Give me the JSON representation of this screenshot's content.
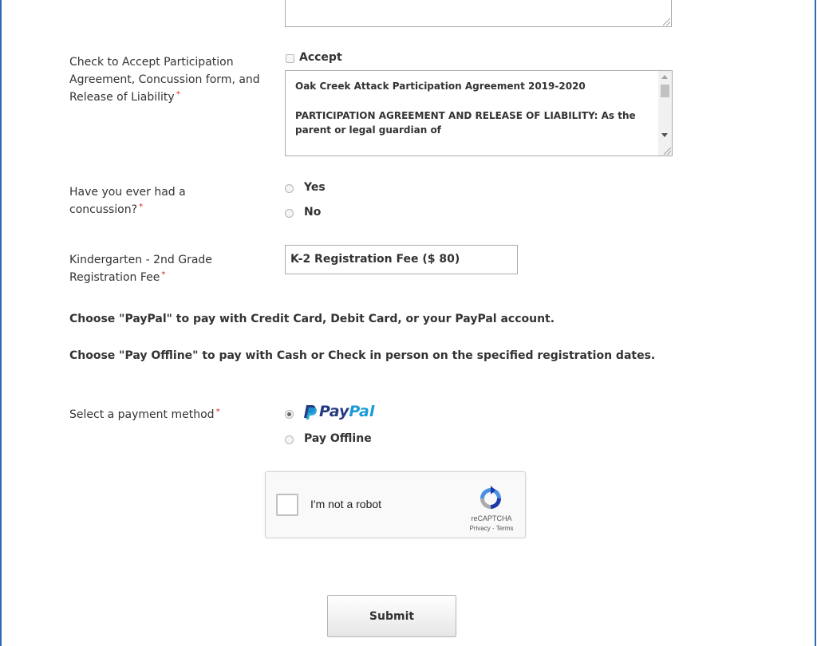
{
  "form": {
    "participation": {
      "label": "Check to Accept Participation Agreement, Concussion form, and Release of Liability",
      "required_mark": "*",
      "accept_label": "Accept",
      "agreement_title": "Oak Creek Attack Participation Agreement 2019-2020",
      "agreement_body": "PARTICIPATION AGREEMENT AND RELEASE OF LIABILITY: As the parent or legal guardian of"
    },
    "concussion": {
      "label": "Have you ever had a concussion?",
      "required_mark": "*",
      "options": [
        "Yes",
        "No"
      ]
    },
    "fee": {
      "label": "Kindergarten - 2nd Grade Registration Fee",
      "required_mark": "*",
      "value": "K-2 Registration Fee ($ 80)"
    },
    "notes": {
      "paypal": "Choose \"PayPal\" to pay with Credit Card, Debit Card, or your PayPal account.",
      "offline": "Choose \"Pay Offline\" to pay with Cash or Check in person on the specified registration dates."
    },
    "payment": {
      "label": "Select a payment method",
      "required_mark": "*",
      "paypal_logo_pay": "Pay",
      "paypal_logo_pal": "Pal",
      "offline_label": "Pay Offline",
      "selected": "PayPal"
    },
    "captcha": {
      "label": "I'm not a robot",
      "brand": "reCAPTCHA",
      "links": "Privacy - Terms"
    },
    "submit_label": "Submit"
  },
  "colors": {
    "frame": "#2d6cb5",
    "required": "#e02020",
    "paypal_dark": "#253b80",
    "paypal_light": "#179bd7"
  }
}
